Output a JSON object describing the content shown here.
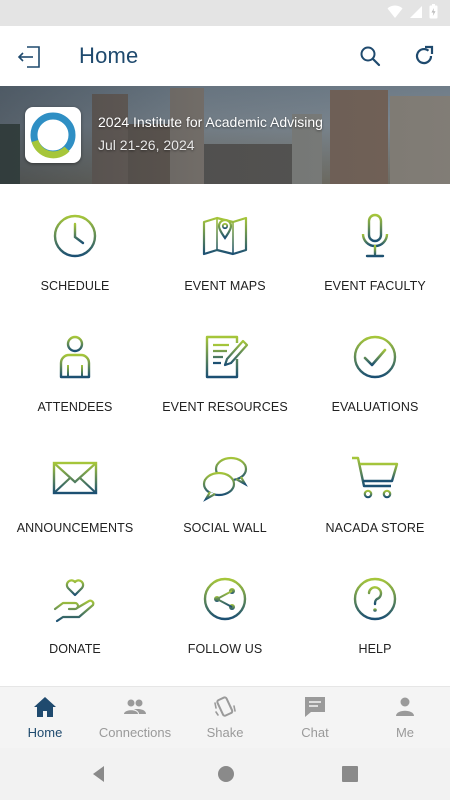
{
  "header": {
    "title": "Home"
  },
  "event": {
    "title": "2024 Institute for Academic Advising",
    "dates": "Jul 21-26, 2024"
  },
  "tiles": [
    {
      "label": "SCHEDULE",
      "icon": "clock-icon"
    },
    {
      "label": "EVENT MAPS",
      "icon": "map-icon"
    },
    {
      "label": "EVENT FACULTY",
      "icon": "microphone-icon"
    },
    {
      "label": "ATTENDEES",
      "icon": "person-icon"
    },
    {
      "label": "EVENT RESOURCES",
      "icon": "document-edit-icon"
    },
    {
      "label": "EVALUATIONS",
      "icon": "check-circle-icon"
    },
    {
      "label": "ANNOUNCEMENTS",
      "icon": "envelope-icon"
    },
    {
      "label": "SOCIAL WALL",
      "icon": "chat-bubbles-icon"
    },
    {
      "label": "NACADA STORE",
      "icon": "shopping-cart-icon"
    },
    {
      "label": "DONATE",
      "icon": "heart-hand-icon"
    },
    {
      "label": "FOLLOW US",
      "icon": "share-icon"
    },
    {
      "label": "HELP",
      "icon": "question-circle-icon"
    }
  ],
  "bottom_nav": [
    {
      "label": "Home",
      "icon": "home-icon",
      "active": true
    },
    {
      "label": "Connections",
      "icon": "people-icon",
      "active": false
    },
    {
      "label": "Shake",
      "icon": "shake-icon",
      "active": false
    },
    {
      "label": "Chat",
      "icon": "chat-icon",
      "active": false
    },
    {
      "label": "Me",
      "icon": "user-icon",
      "active": false
    }
  ],
  "colors": {
    "primary": "#1f4a6e",
    "icon_gradient_top": "#a6c63a",
    "icon_gradient_bottom": "#1b4f73",
    "inactive": "#9a9a9a"
  }
}
